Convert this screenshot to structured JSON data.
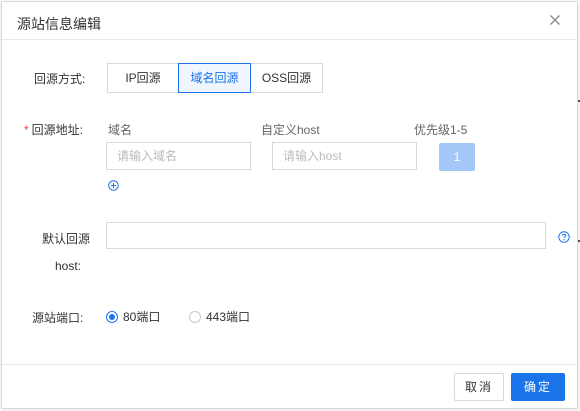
{
  "dialog": {
    "title": "源站信息编辑",
    "close_icon": "close-icon"
  },
  "origin_mode": {
    "label": "回源方式:",
    "options": [
      "IP回源",
      "域名回源",
      "OSS回源"
    ],
    "selected": "域名回源"
  },
  "origin_address": {
    "required_mark": "*",
    "label": "回源地址:",
    "columns": {
      "domain": "域名",
      "custom_host": "自定义host",
      "priority": "优先级1-5"
    },
    "domain_placeholder": "请输入域名",
    "domain_value": "",
    "host_placeholder": "请输入host",
    "host_value": "",
    "priority_value": "1",
    "add_icon": "plus-circle-icon"
  },
  "default_host": {
    "label_line1": "默认回源",
    "label_line2": "host:",
    "value": "",
    "help_icon": "question-circle-icon"
  },
  "origin_port": {
    "label": "源站端口:",
    "options": [
      "80端口",
      "443端口"
    ],
    "selected": "80端口"
  },
  "footer": {
    "cancel_label": "取消",
    "ok_label": "确定"
  },
  "colors": {
    "accent": "#1a73e8",
    "priority_disabled": "#a3c7f7",
    "required": "#e5493b"
  }
}
